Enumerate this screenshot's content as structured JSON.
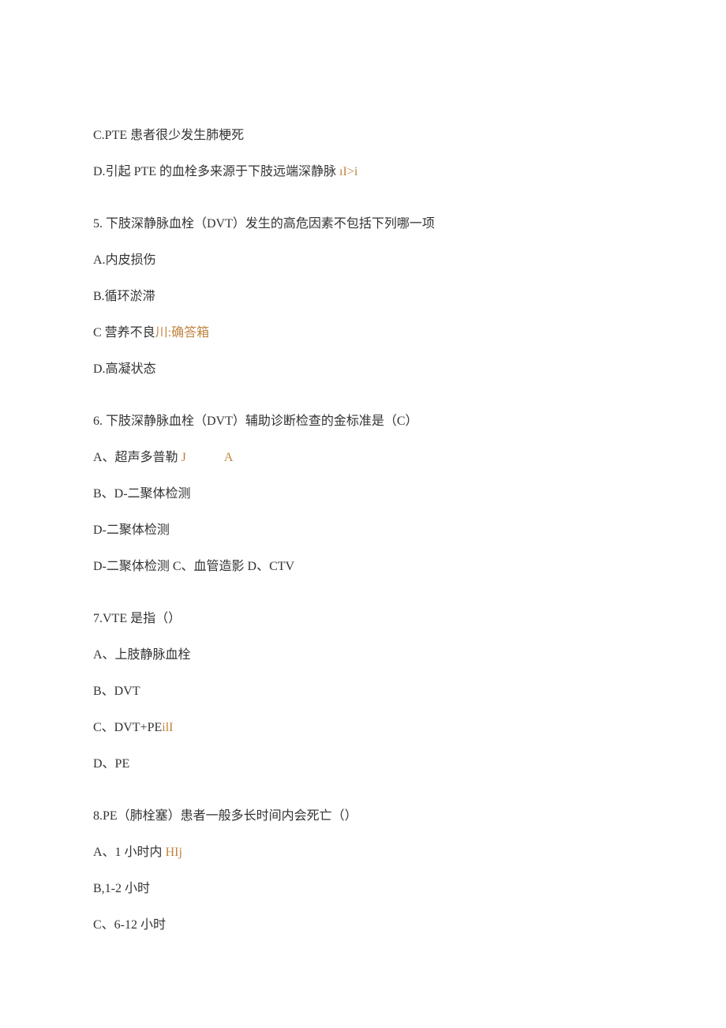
{
  "q4": {
    "optC": {
      "label": "C.",
      "text": "PTE 患者很少发生肺梗死"
    },
    "optD": {
      "label": "D.",
      "text": "引起 PTE 的血栓多来源于下肢远端深静脉",
      "hl": " ıI>i"
    }
  },
  "q5": {
    "stem": "5. 下肢深静脉血栓（DVT）发生的高危因素不包括下列哪一项",
    "optA": {
      "label": "A.",
      "text": "内皮损伤"
    },
    "optB": {
      "label": "B.",
      "text": "循环淤滞"
    },
    "optC": {
      "label": "C",
      "text": " 营养不良",
      "hl": "川:确答箱"
    },
    "optD": {
      "label": "D.",
      "text": "高凝状态"
    }
  },
  "q6": {
    "stem": "6. 下肢深静脉血栓（DVT）辅助诊断检查的金标准是（C）",
    "optA": {
      "text": "A、超声多普勒",
      "hl1": " J",
      "sp": "　　　",
      "hl2": "A"
    },
    "optB": {
      "text": "B、D-二聚体检测"
    },
    "line3": {
      "text": "D-二聚体检测"
    },
    "line4": {
      "text": "D-二聚体检测 C、血管造影 D、CTV"
    }
  },
  "q7": {
    "stem": "7.VTE 是指（）",
    "optA": {
      "text": "A、上肢静脉血栓"
    },
    "optB": {
      "text": "B、DVT"
    },
    "optC": {
      "text": "C、DVT+PE",
      "hl": "ilI"
    },
    "optD": {
      "text": "D、PE"
    }
  },
  "q8": {
    "stem": "8.PE（肺栓塞）患者一般多长时间内会死亡（）",
    "optA": {
      "text": "A、1 小时内",
      "hl": " HIj"
    },
    "optB": {
      "text": "B,1-2 小时"
    },
    "optC": {
      "text": "C、6-12 小时"
    }
  }
}
